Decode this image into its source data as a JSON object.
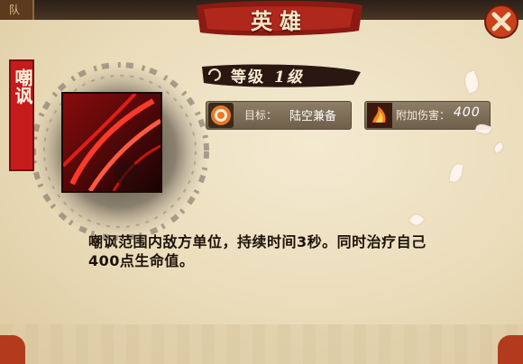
{
  "header": {
    "corner_label": "队",
    "title": "英雄"
  },
  "close_button": {
    "icon": "close-x-icon"
  },
  "skill": {
    "name": "嘲讽",
    "level_label": "等级",
    "level_value": "1级",
    "icon": "taunt-skill-icon"
  },
  "info": {
    "target_label": "目标：",
    "target_value": "陆空兼备",
    "damage_label": "附加伤害：",
    "damage_value": "400"
  },
  "description": "嘲讽范围内敌方单位，持续时间3秒。同时治疗自己400点生命值。",
  "colors": {
    "accent_red": "#c61b1b",
    "parchment": "#efe3c4",
    "text_dark": "#1c120a"
  }
}
